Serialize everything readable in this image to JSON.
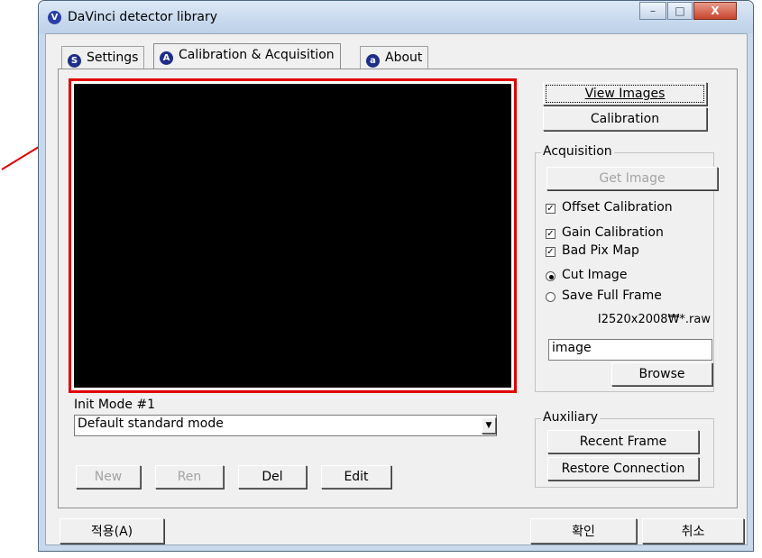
{
  "window": {
    "title": "DaVinci detector library",
    "app_icon_letter": "V",
    "controls": {
      "minimize": "–",
      "maximize": "□",
      "close": "X"
    }
  },
  "tabs": [
    {
      "label": "Settings",
      "icon_letter": "S",
      "icon": "settings-icon"
    },
    {
      "label": "Calibration & Acquisition",
      "icon_letter": "A",
      "icon": "acquisition-icon",
      "active": true
    },
    {
      "label": "About",
      "icon_letter": "a",
      "icon": "about-icon"
    }
  ],
  "right_panel": {
    "view_images": "View Images",
    "calibration": "Calibration",
    "acquisition": {
      "label": "Acquisition",
      "get_image": "Get Image",
      "offset_calibration": "Offset Calibration",
      "gain_calibration": "Gain Calibration",
      "bad_pix_map": "Bad Pix Map",
      "cut_image": "Cut Image",
      "save_full_frame": "Save Full Frame",
      "file_pattern": "I2520x2008₩*.raw",
      "filename_value": "image",
      "browse": "Browse"
    },
    "auxiliary": {
      "label": "Auxiliary",
      "recent_frame": "Recent Frame",
      "restore_connection": "Restore Connection"
    }
  },
  "init_mode": {
    "label": "Init Mode #1",
    "selected": "Default standard mode"
  },
  "mode_buttons": {
    "new": "New",
    "ren": "Ren",
    "del": "Del",
    "edit": "Edit"
  },
  "footer": {
    "apply": "적용(A)",
    "ok": "확인",
    "cancel": "취소"
  },
  "colors": {
    "highlight": "#e00000",
    "preview_bg": "#000000"
  }
}
